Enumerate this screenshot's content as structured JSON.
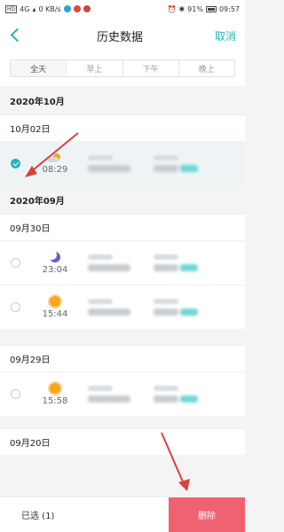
{
  "status_bar": {
    "left_icons": [
      "HD",
      "4G",
      "wifi",
      "0 KB/s",
      "notification-icons"
    ],
    "battery": "91%",
    "time": "09:57"
  },
  "nav": {
    "title": "历史数据",
    "cancel": "取消"
  },
  "tabs": [
    "全天",
    "早上",
    "下午",
    "晚上"
  ],
  "groups": [
    {
      "month": "2020年10月",
      "days": [
        {
          "date": "10月02日",
          "entries": [
            {
              "time": "08:29",
              "icon": "partly-cloudy-icon",
              "checked": true
            }
          ]
        }
      ]
    },
    {
      "month": "2020年09月",
      "days": [
        {
          "date": "09月30日",
          "entries": [
            {
              "time": "23:04",
              "icon": "moon-icon",
              "checked": false
            },
            {
              "time": "15:44",
              "icon": "sun-icon",
              "checked": false
            }
          ]
        },
        {
          "date": "09月29日",
          "entries": [
            {
              "time": "15:58",
              "icon": "sun-icon",
              "checked": false
            }
          ]
        },
        {
          "date": "09月20日",
          "entries": []
        }
      ]
    }
  ],
  "bottom_bar": {
    "selected_label": "已选 (1)",
    "delete_label": "删除"
  },
  "colors": {
    "accent": "#26b3b9",
    "delete": "#f06272",
    "arrow": "#d9403a"
  }
}
